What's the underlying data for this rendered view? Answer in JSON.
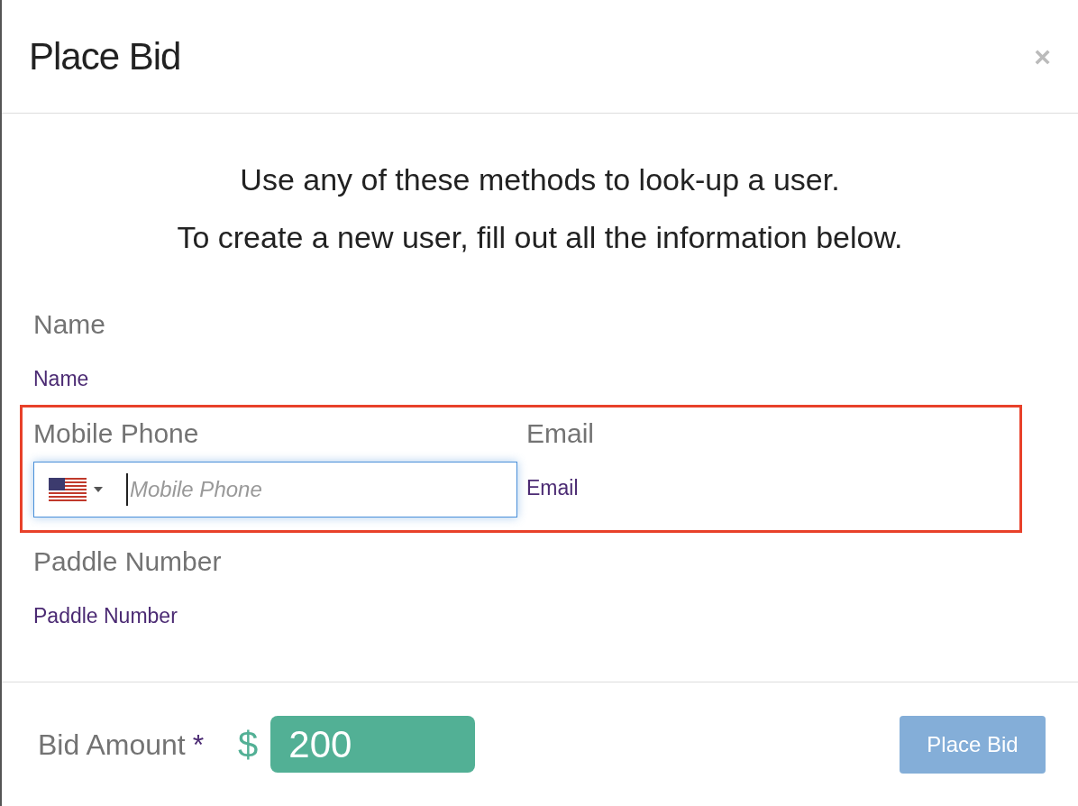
{
  "modal": {
    "title": "Place Bid",
    "close": "×"
  },
  "instructions": [
    "Use any of these methods to look-up a user.",
    "To create a new user, fill out all the information below."
  ],
  "fields": [
    {
      "kind": "editable",
      "label": "Name",
      "value": "Name",
      "highlighted": false
    },
    {
      "kind": "phone",
      "label": "Mobile Phone",
      "placeholder": "Mobile Phone",
      "focused": true,
      "highlighted": true
    },
    {
      "kind": "editable",
      "label": "Email",
      "value": "Email",
      "highlighted": true
    },
    {
      "kind": "editable",
      "label": "Paddle Number",
      "value": "Paddle Number",
      "highlighted": false
    }
  ],
  "footer": {
    "label": "Bid Amount",
    "required_mark": "*",
    "currency": "$",
    "amount": "200",
    "button": {
      "label": "Place Bid",
      "disabled": true
    }
  }
}
